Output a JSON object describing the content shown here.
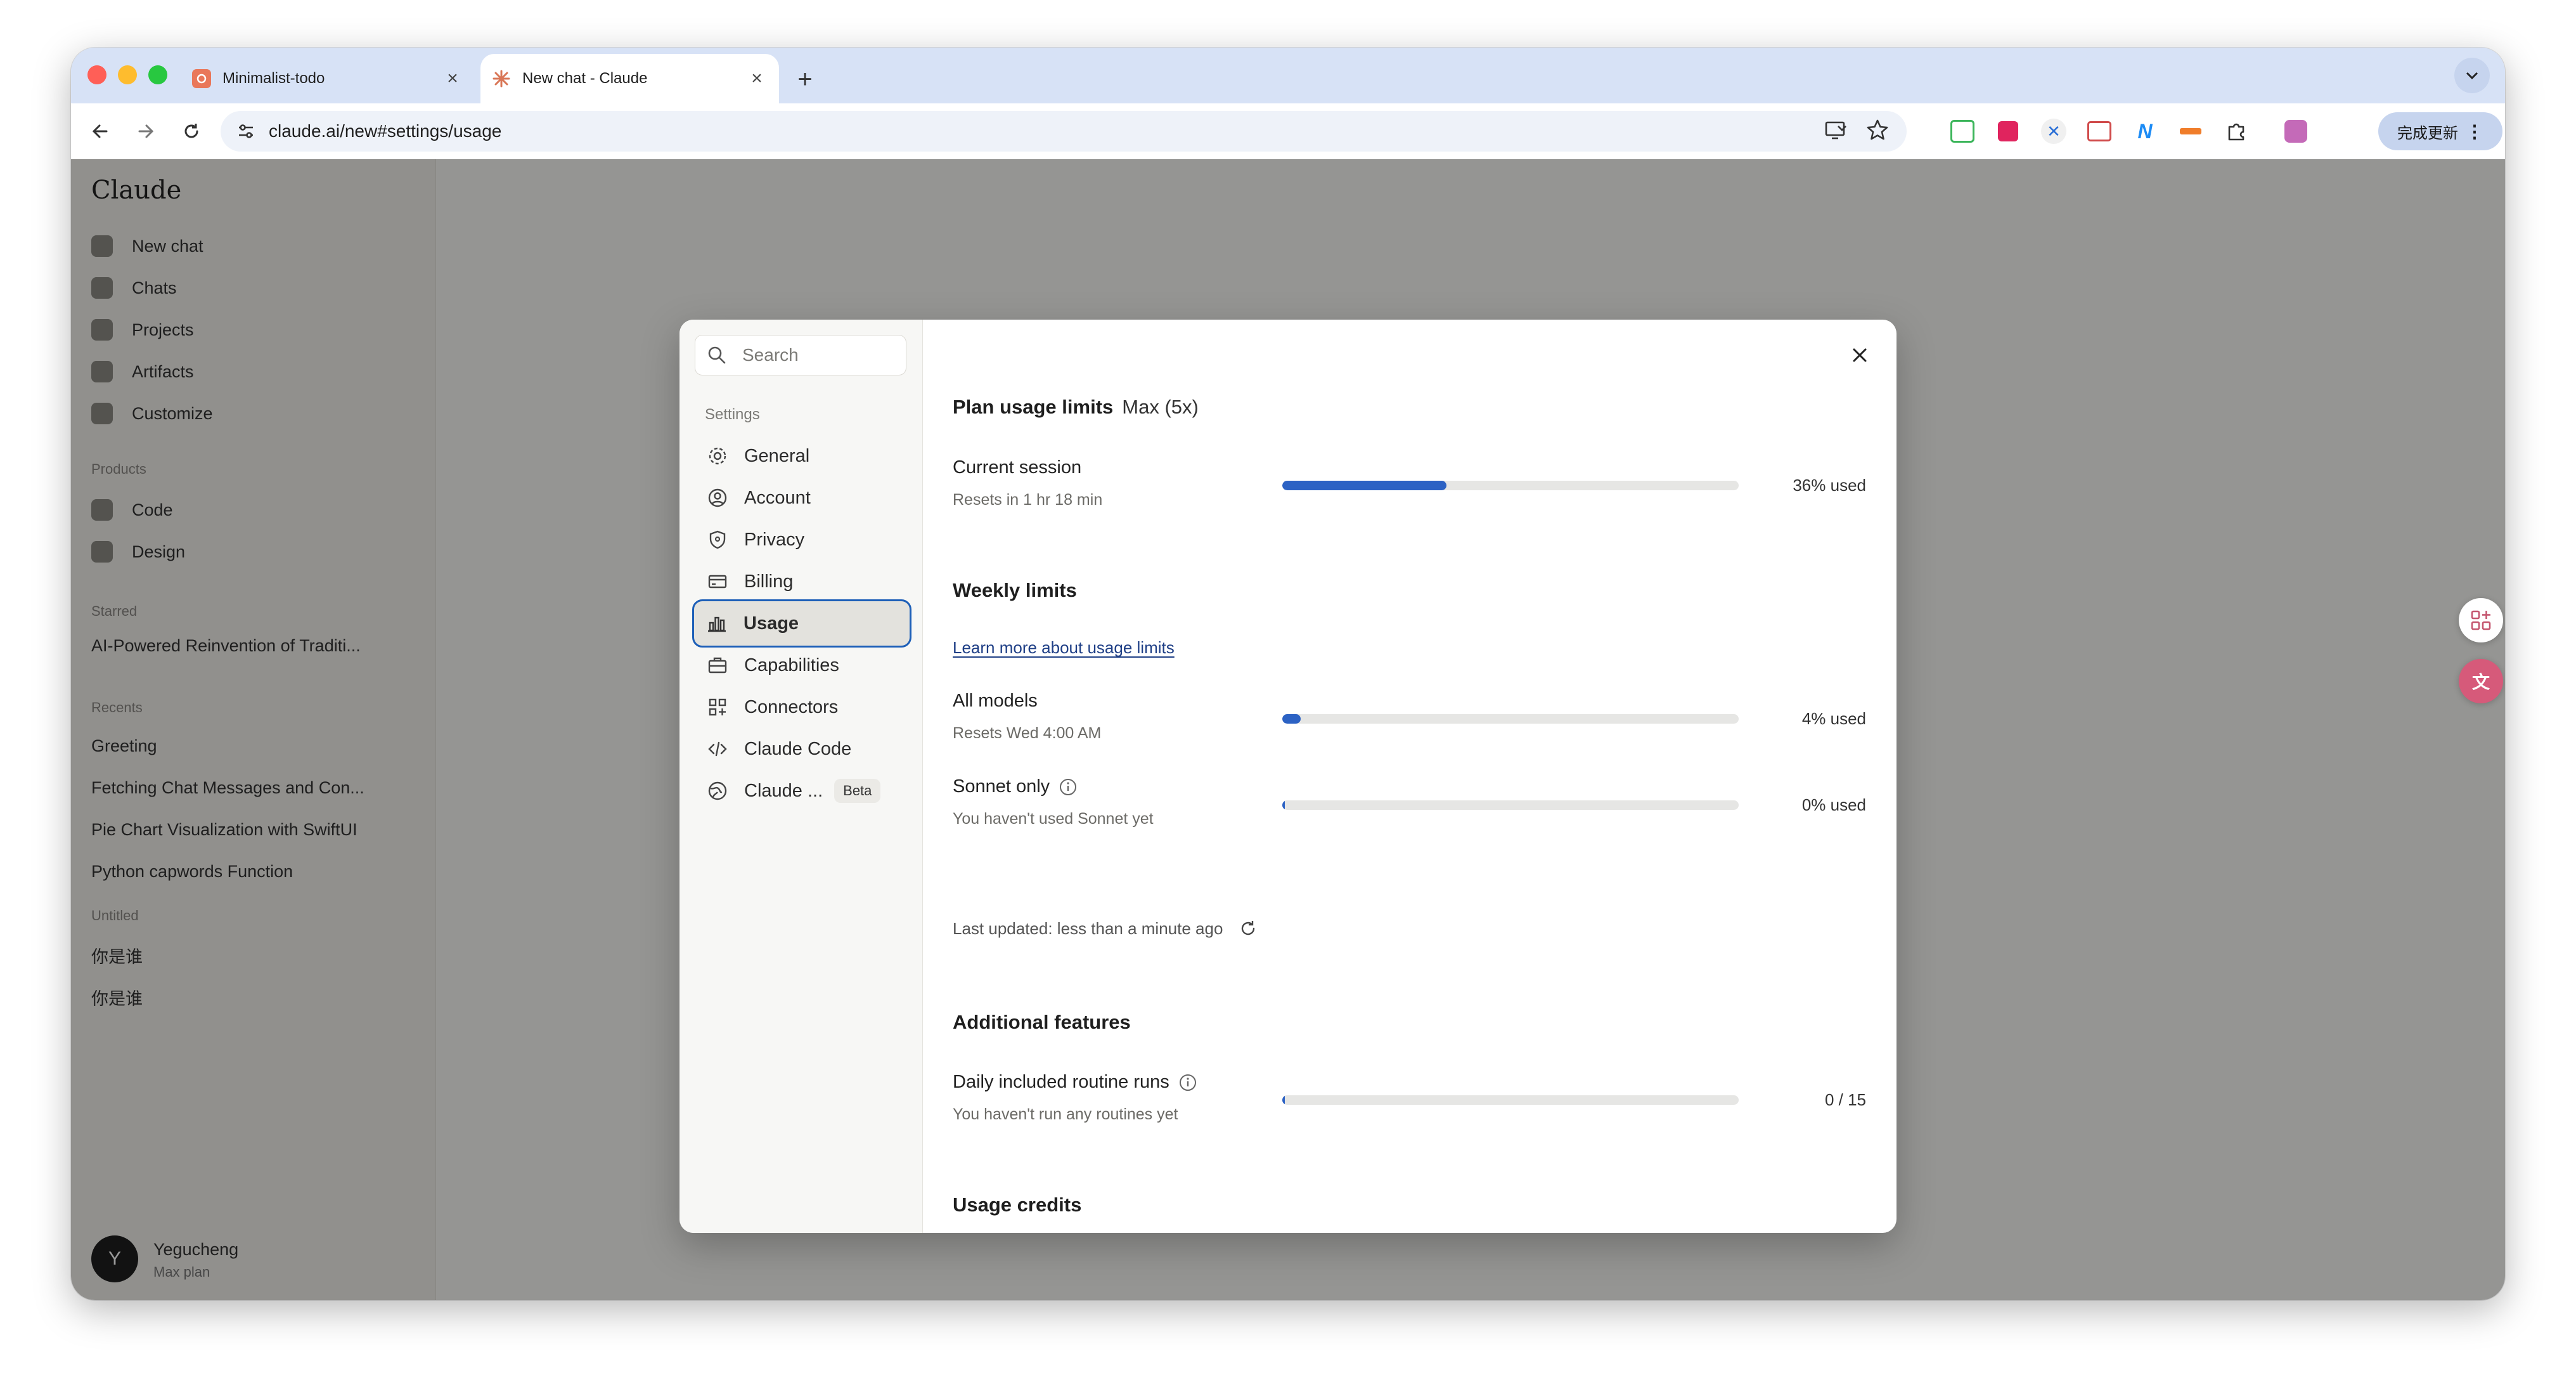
{
  "browser": {
    "tabs": [
      {
        "title": "Minimalist-todo"
      },
      {
        "title": "New chat - Claude"
      }
    ],
    "url": "claude.ai/new#settings/usage",
    "update_button": "完成更新"
  },
  "sidebar": {
    "logo": "Claude",
    "nav": [
      "New chat",
      "Chats",
      "Projects",
      "Artifacts",
      "Customize"
    ],
    "products_heading": "Products",
    "products": [
      "Code",
      "Design"
    ],
    "starred_heading": "Starred",
    "starred": [
      "AI-Powered Reinvention of Traditi..."
    ],
    "recents_heading": "Recents",
    "recents": [
      "Greeting",
      "Fetching Chat Messages and Con...",
      "Pie Chart Visualization with SwiftUI",
      "Python capwords Function"
    ],
    "untitled_heading": "Untitled",
    "untitled": [
      "你是谁",
      "你是谁"
    ],
    "user": {
      "initial": "Y",
      "name": "Yegucheng",
      "plan": "Max plan"
    }
  },
  "settings_nav": {
    "search_placeholder": "Search",
    "section_label": "Settings",
    "items": [
      {
        "label": "General"
      },
      {
        "label": "Account"
      },
      {
        "label": "Privacy"
      },
      {
        "label": "Billing"
      },
      {
        "label": "Usage"
      },
      {
        "label": "Capabilities"
      },
      {
        "label": "Connectors"
      },
      {
        "label": "Claude Code"
      },
      {
        "label": "Claude ...",
        "badge": "Beta"
      }
    ],
    "active": "Usage"
  },
  "usage": {
    "plan_title": "Plan usage limits",
    "plan_name": "Max (5x)",
    "current_session": {
      "title": "Current session",
      "subtitle": "Resets in 1 hr 18 min",
      "percent": 36,
      "value_label": "36% used"
    },
    "weekly_title": "Weekly limits",
    "learn_more": "Learn more about usage limits",
    "all_models": {
      "title": "All models",
      "subtitle": "Resets Wed 4:00 AM",
      "percent": 4,
      "value_label": "4% used"
    },
    "sonnet_only": {
      "title": "Sonnet only",
      "subtitle": "You haven't used Sonnet yet",
      "percent": 0,
      "value_label": "0% used"
    },
    "last_updated": "Last updated: less than a minute ago",
    "additional_title": "Additional features",
    "routine_runs": {
      "title": "Daily included routine runs",
      "subtitle": "You haven't run any routines yet",
      "used": 0,
      "total": 15,
      "value_label": "0 / 15"
    },
    "credits_title": "Usage credits"
  },
  "colors": {
    "bar_fill": "#2c62c4",
    "active_outline": "#1d5fb8"
  }
}
